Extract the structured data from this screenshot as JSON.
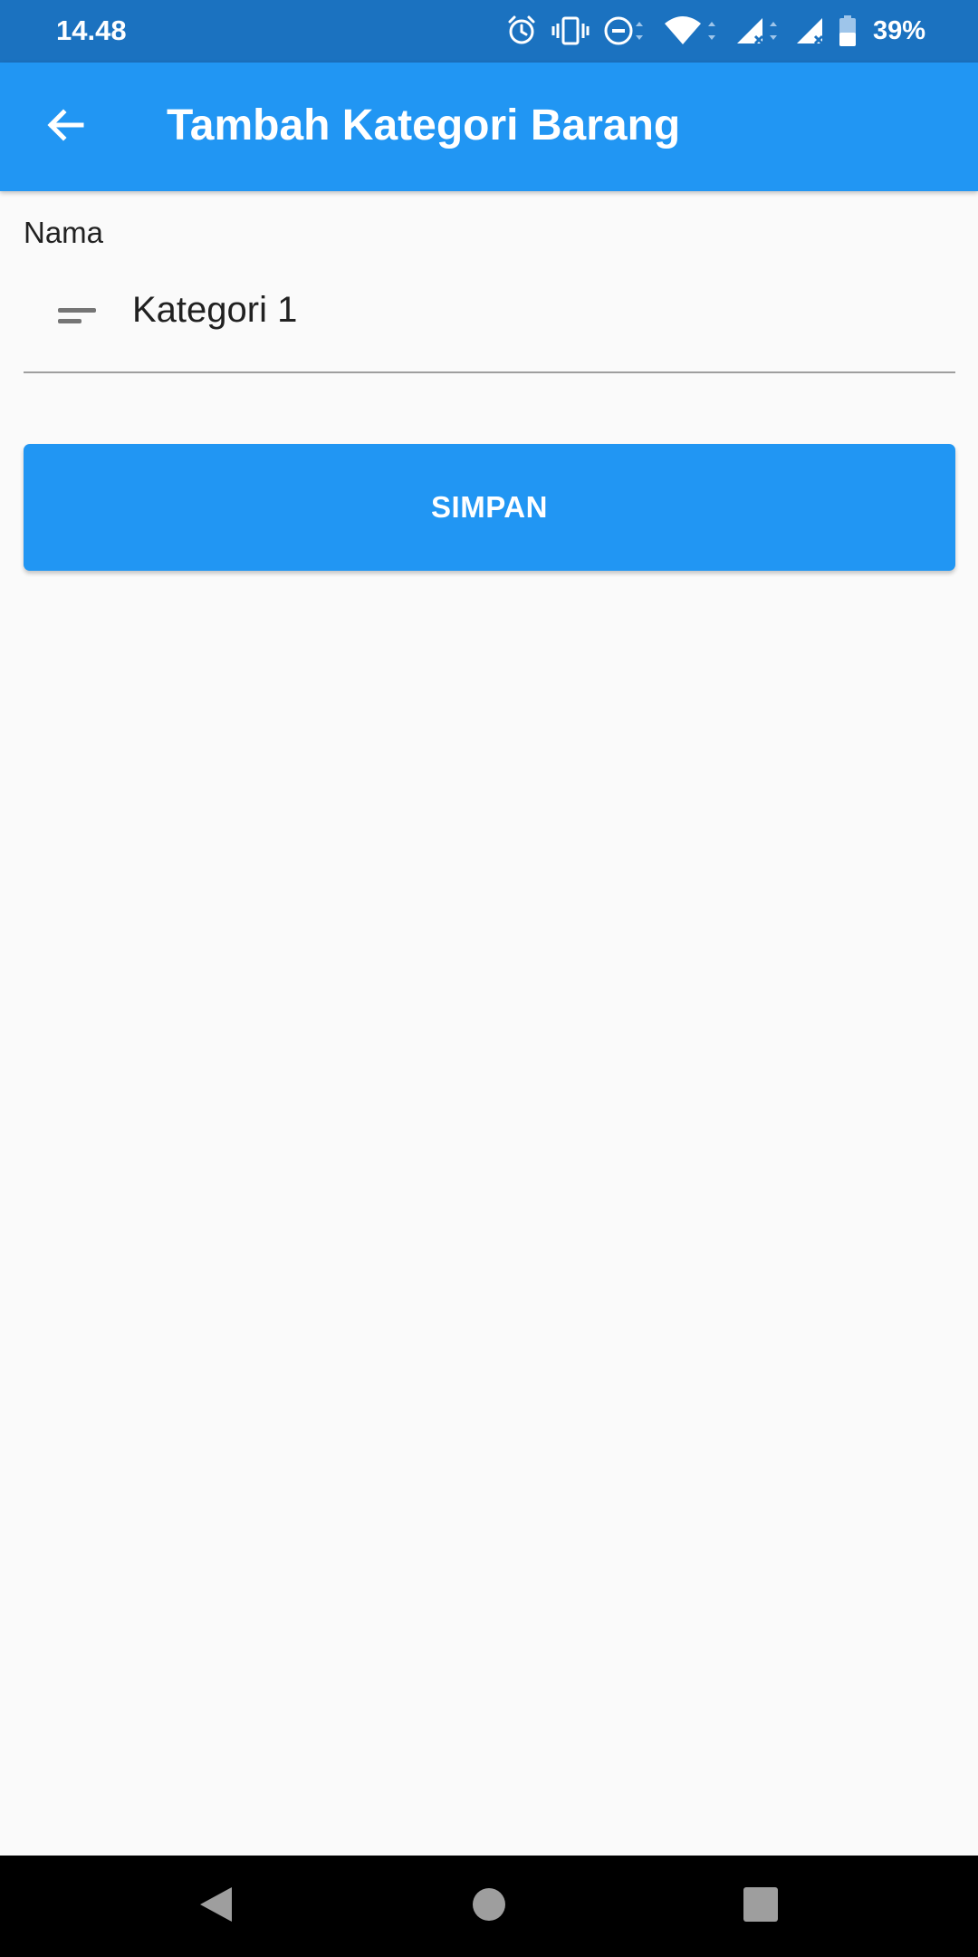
{
  "status_bar": {
    "time": "14.48",
    "battery_percent": "39%",
    "icons": [
      "alarm-icon",
      "vibrate-icon",
      "do-not-disturb-icon",
      "wifi-icon",
      "signal-no-sim-icon",
      "signal-no-sim-icon",
      "battery-icon"
    ]
  },
  "app_bar": {
    "title": "Tambah Kategori Barang",
    "back_icon": "arrow-back-icon"
  },
  "form": {
    "name_label": "Nama",
    "name_value": "Kategori 1",
    "name_icon": "short-text-icon"
  },
  "actions": {
    "save_label": "SIMPAN"
  },
  "nav_bar": {
    "icons": [
      "back-triangle-icon",
      "home-circle-icon",
      "recents-square-icon"
    ]
  },
  "colors": {
    "status_bar": "#1b72c0",
    "primary": "#2196f3",
    "background": "#fafafa",
    "text": "#212121",
    "underline": "#9e9e9e",
    "nav_bar": "#000000",
    "nav_icon": "#9e9e9e"
  }
}
